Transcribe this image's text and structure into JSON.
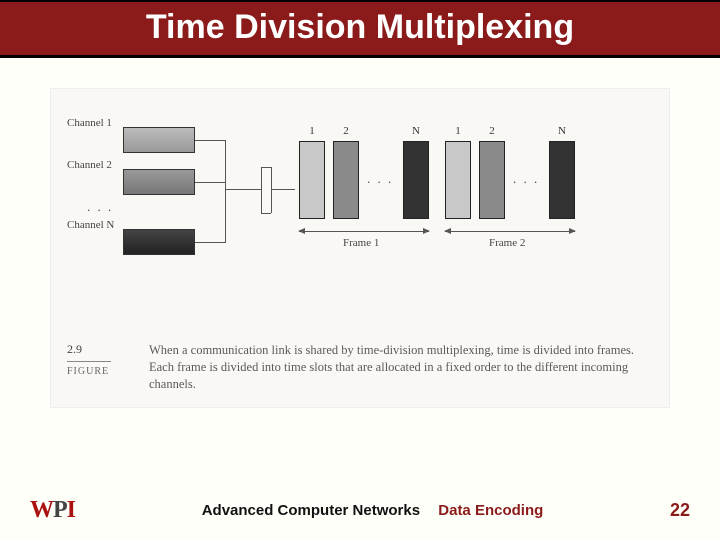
{
  "title": "Time Division Multiplexing",
  "channels": {
    "c1": "Channel 1",
    "c2": "Channel 2",
    "cn": "Channel N",
    "dots": ". . ."
  },
  "slots": {
    "s1": "1",
    "s2": "2",
    "sn": "N",
    "dots": ". . ."
  },
  "frames": {
    "f1": "Frame 1",
    "f2": "Frame 2"
  },
  "figure": {
    "number": "2.9",
    "word": "FIGURE",
    "caption": "When a communication link is shared by time-division multiplexing, time is divided into frames. Each frame is divided into time slots that are allocated in a fixed order to the different incoming channels."
  },
  "footer": {
    "course": "Advanced Computer Networks",
    "topic": "Data Encoding",
    "page": "22",
    "logo": {
      "w": "W",
      "p": "P",
      "i": "I"
    }
  }
}
